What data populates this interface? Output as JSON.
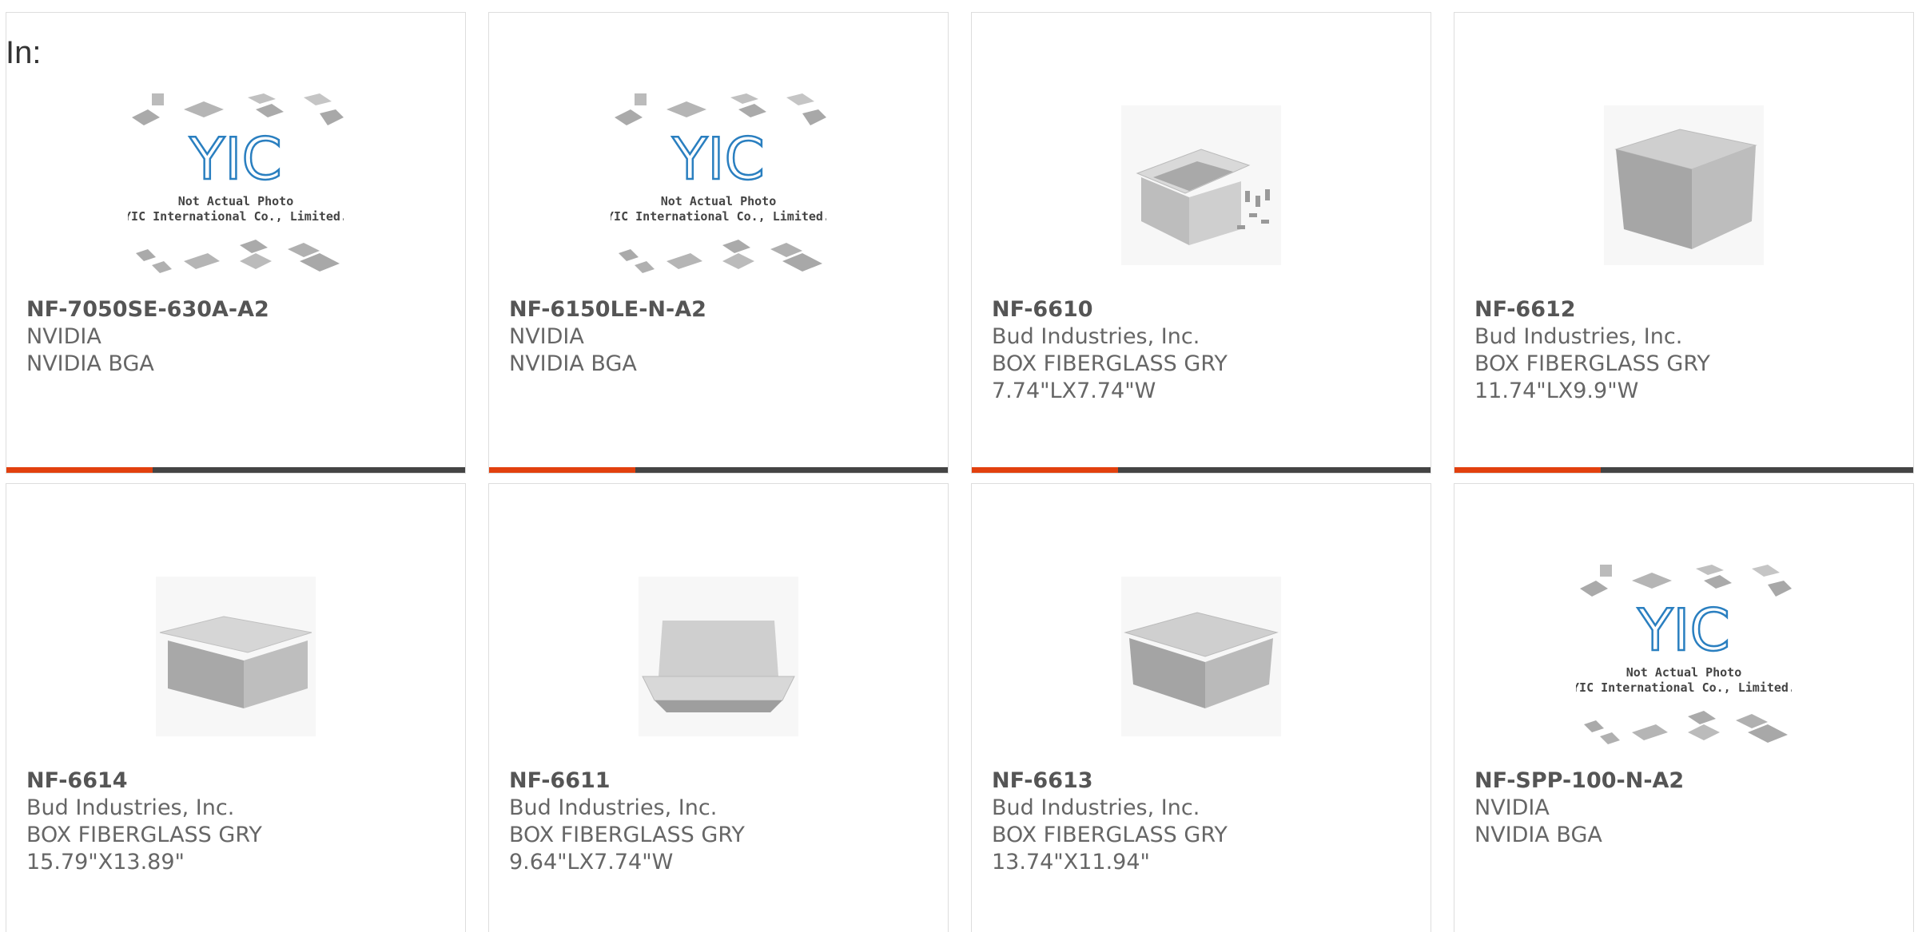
{
  "page": {
    "in_label": "In:"
  },
  "placeholder": {
    "line1": "Not Actual Photo",
    "line2": "YIC International Co., Limited.",
    "logo": "YIC"
  },
  "accent_color": "#e2400e",
  "products": [
    {
      "part": "NF-7050SE-630A-A2",
      "maker": "NVIDIA",
      "desc1": "NVIDIA BGA",
      "desc2": "",
      "image": "placeholder-logo"
    },
    {
      "part": "NF-6150LE-N-A2",
      "maker": "NVIDIA",
      "desc1": "NVIDIA BGA",
      "desc2": "",
      "image": "placeholder-logo"
    },
    {
      "part": "NF-6610",
      "maker": "Bud Industries, Inc.",
      "desc1": "BOX FIBERGLASS GRY",
      "desc2": "7.74\"LX7.74\"W",
      "image": "enclosure-open-with-hardware"
    },
    {
      "part": "NF-6612",
      "maker": "Bud Industries, Inc.",
      "desc1": "BOX FIBERGLASS GRY",
      "desc2": "11.74\"LX9.9\"W",
      "image": "enclosure-closed-tall"
    },
    {
      "part": "NF-6614",
      "maker": "Bud Industries, Inc.",
      "desc1": "BOX FIBERGLASS GRY",
      "desc2": "15.79\"X13.89\"",
      "image": "enclosure-closed"
    },
    {
      "part": "NF-6611",
      "maker": "Bud Industries, Inc.",
      "desc1": "BOX FIBERGLASS GRY",
      "desc2": "9.64\"LX7.74\"W",
      "image": "enclosure-inverted"
    },
    {
      "part": "NF-6613",
      "maker": "Bud Industries, Inc.",
      "desc1": "BOX FIBERGLASS GRY",
      "desc2": "13.74\"X11.94\"",
      "image": "enclosure-closed"
    },
    {
      "part": "NF-SPP-100-N-A2",
      "maker": "NVIDIA",
      "desc1": "NVIDIA BGA",
      "desc2": "",
      "image": "placeholder-logo"
    }
  ]
}
